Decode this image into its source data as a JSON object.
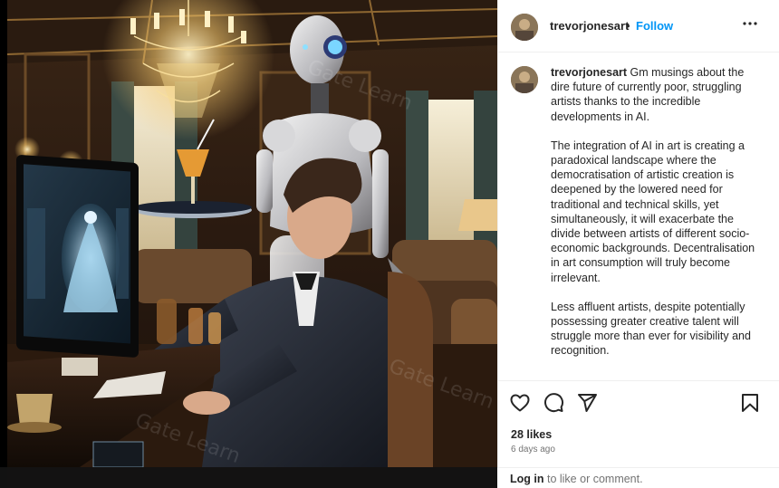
{
  "post": {
    "username": "trevorjonesart",
    "separator": "•",
    "follow_label": "Follow",
    "more_icon": "more-horizontal-icon",
    "image_description_icon": "post-artwork-image"
  },
  "caption": {
    "username": "trevorjonesart",
    "paragraphs": [
      "Gm musings about the dire future of currently poor, struggling artists thanks to the incredible developments in AI.",
      "The integration of AI in art is creating a paradoxical landscape where the democratisation of artistic creation is deepened by the lowered need for traditional and technical skills, yet simultaneously, it will exacerbate the divide between artists of different socio-economic backgrounds. Decentralisation in art consumption will truly become irrelevant.",
      "Less affluent artists, despite potentially possessing greater creative talent will struggle more than ever for visibility and recognition."
    ]
  },
  "actions": {
    "like_icon": "heart-icon",
    "comment_icon": "comment-icon",
    "share_icon": "share-icon",
    "save_icon": "bookmark-icon"
  },
  "stats": {
    "likes": "28 likes",
    "time_ago": "6 days ago"
  },
  "login": {
    "link": "Log in",
    "rest": "to like or comment."
  },
  "colors": {
    "follow_blue": "#0095f6",
    "text_primary": "#262626",
    "text_secondary": "#737373"
  }
}
